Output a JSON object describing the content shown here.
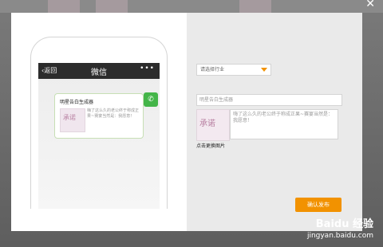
{
  "close_icon": "close-icon",
  "phone": {
    "back_label": "返回",
    "title": "微信",
    "more_label": "•••",
    "message": {
      "title": "明星告白生成器",
      "image_text": "承诺",
      "description": "嗨了这么久的老公终于称成正果~赛宴当然是：我愿意！"
    },
    "wechat_icon_label": "✆"
  },
  "form": {
    "industry_select": "请选择行业",
    "title_value": "明星告白生成器",
    "image_text": "承诺",
    "description_value": "嗨了这么久的老公终于称成正果~赛宴当然是：我愿意！",
    "click_modify_label": "点击更换图片",
    "confirm_label": "确认发布"
  },
  "watermark": {
    "brand": "Baidu 经验",
    "url": "jingyan.baidu.com"
  },
  "colors": {
    "accent": "#f29200",
    "wechat_green": "#44b549",
    "overlay": "#6b6b6b"
  }
}
